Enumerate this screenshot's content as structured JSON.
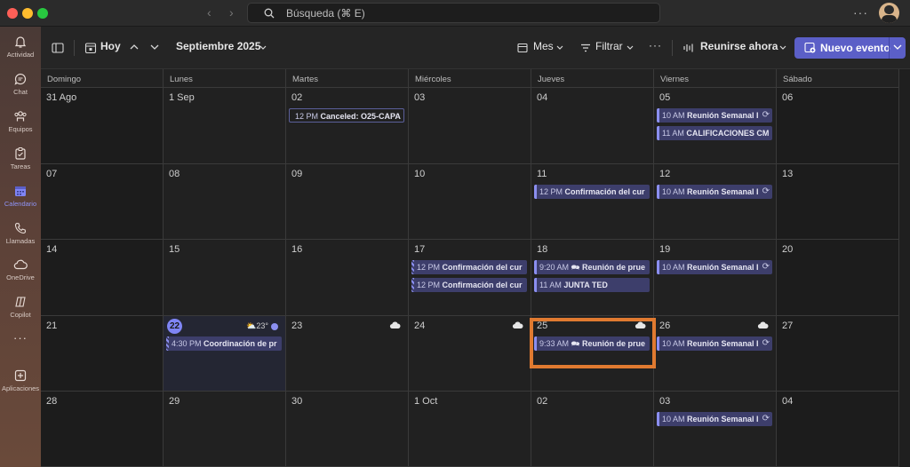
{
  "search": {
    "placeholder": "Búsqueda (⌘ E)"
  },
  "rail": [
    {
      "label": "Actividad",
      "icon": "bell-icon"
    },
    {
      "label": "Chat",
      "icon": "chat-icon"
    },
    {
      "label": "Equipos",
      "icon": "teams-icon"
    },
    {
      "label": "Tareas",
      "icon": "tasks-icon"
    },
    {
      "label": "Calendario",
      "icon": "calendar-icon",
      "active": true
    },
    {
      "label": "Llamadas",
      "icon": "phone-icon"
    },
    {
      "label": "OneDrive",
      "icon": "cloud-icon"
    },
    {
      "label": "Copilot",
      "icon": "copilot-icon"
    },
    {
      "label": "Aplicaciones",
      "icon": "add-apps-icon"
    }
  ],
  "toolbar": {
    "today": "Hoy",
    "month_label": "Septiembre 2025",
    "view": "Mes",
    "filter": "Filtrar",
    "meet_now": "Reunirse ahora",
    "new_event": "Nuevo evento"
  },
  "weekdays": [
    "Domingo",
    "Lunes",
    "Martes",
    "Miércoles",
    "Jueves",
    "Viernes",
    "Sábado"
  ],
  "weeks": [
    [
      "31 Ago",
      "1 Sep",
      "02",
      "03",
      "04",
      "05",
      "06"
    ],
    [
      "07",
      "08",
      "09",
      "10",
      "11",
      "12",
      "13"
    ],
    [
      "14",
      "15",
      "16",
      "17",
      "18",
      "19",
      "20"
    ],
    [
      "21",
      "22",
      "23",
      "24",
      "25",
      "26",
      "27"
    ],
    [
      "28",
      "29",
      "30",
      "1 Oct",
      "02",
      "03",
      "04"
    ]
  ],
  "today_weather": "23°",
  "events": [
    {
      "week": 0,
      "day": 2,
      "slot": 0,
      "time": "12 PM",
      "title": "Canceled: O25-CAPA",
      "style": "outline"
    },
    {
      "week": 0,
      "day": 5,
      "slot": 0,
      "time": "10 AM",
      "title": "Reunión Semanal I",
      "recurring": true
    },
    {
      "week": 0,
      "day": 5,
      "slot": 1,
      "time": "11 AM",
      "title": "CALIFICACIONES CM"
    },
    {
      "week": 1,
      "day": 4,
      "slot": 0,
      "time": "12 PM",
      "title": "Confirmación del cur"
    },
    {
      "week": 1,
      "day": 5,
      "slot": 0,
      "time": "10 AM",
      "title": "Reunión Semanal I",
      "recurring": true
    },
    {
      "week": 2,
      "day": 3,
      "slot": 0,
      "time": "12 PM",
      "title": "Confirmación del cur",
      "style": "striped"
    },
    {
      "week": 2,
      "day": 3,
      "slot": 1,
      "time": "12 PM",
      "title": "Confirmación del cur",
      "style": "striped"
    },
    {
      "week": 2,
      "day": 4,
      "slot": 0,
      "time": "9:20 AM",
      "title": "Reunión de prue",
      "chat": true
    },
    {
      "week": 2,
      "day": 4,
      "slot": 1,
      "time": "11 AM",
      "title": "JUNTA TED"
    },
    {
      "week": 2,
      "day": 5,
      "slot": 0,
      "time": "10 AM",
      "title": "Reunión Semanal I",
      "recurring": true
    },
    {
      "week": 3,
      "day": 1,
      "slot": 0,
      "time": "4:30 PM",
      "title": "Coordinación de pr",
      "style": "striped"
    },
    {
      "week": 3,
      "day": 4,
      "slot": 0,
      "time": "9:33 AM",
      "title": "Reunión de prue",
      "chat": true
    },
    {
      "week": 3,
      "day": 5,
      "slot": 0,
      "time": "10 AM",
      "title": "Reunión Semanal I",
      "recurring": true
    },
    {
      "week": 4,
      "day": 5,
      "slot": 0,
      "time": "10 AM",
      "title": "Reunión Semanal I",
      "recurring": true
    }
  ],
  "colors": {
    "accent": "#5b5fc7",
    "highlight": "#e07a30"
  }
}
